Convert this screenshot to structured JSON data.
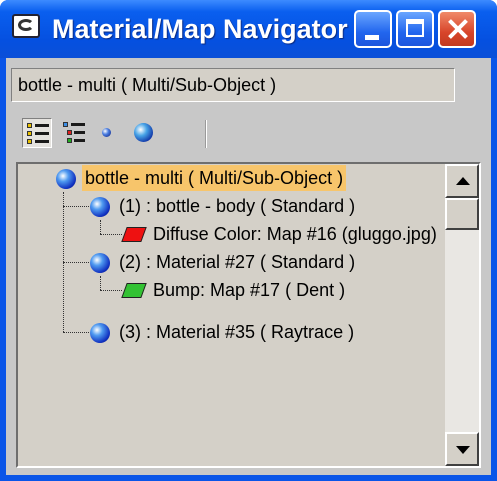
{
  "window": {
    "title": "Material/Map Navigator",
    "accent": "#0a55e8"
  },
  "name_field": {
    "value": "bottle - multi  ( Multi/Sub-Object )"
  },
  "toolbar": {
    "tools": [
      {
        "icon": "list-view-icon",
        "pressed": true
      },
      {
        "icon": "list-small-icons-icon",
        "pressed": false
      },
      {
        "icon": "small-icons-icon",
        "pressed": false
      },
      {
        "icon": "large-icons-icon",
        "pressed": false
      }
    ]
  },
  "tree": {
    "selected_color": "#f7c56b",
    "items": [
      {
        "icon": "material-sphere-icon",
        "label": "bottle - multi  ( Multi/Sub-Object )",
        "selected": true
      },
      {
        "icon": "material-sphere-icon",
        "label": "(1) : bottle - body  ( Standard )"
      },
      {
        "icon": "map-parallelogram-red-icon",
        "label": "Diffuse Color: Map #16 (gluggo.jpg)"
      },
      {
        "icon": "material-sphere-icon",
        "label": "(2) : Material #27  ( Standard )"
      },
      {
        "icon": "map-parallelogram-green-icon",
        "label": "Bump: Map #17  ( Dent )"
      },
      {
        "icon": "material-sphere-icon",
        "label": "(3) : Material #35  ( Raytrace )"
      }
    ]
  }
}
